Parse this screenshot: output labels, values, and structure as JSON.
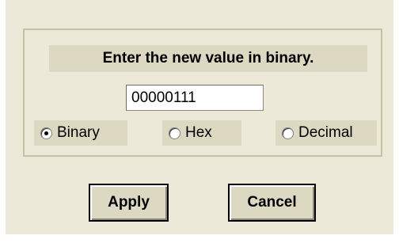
{
  "dialog": {
    "instruction": "Enter the new value in binary.",
    "value_input": "00000111",
    "radios": {
      "binary": {
        "label": "Binary",
        "checked": true
      },
      "hex": {
        "label": "Hex",
        "checked": false
      },
      "decimal": {
        "label": "Decimal",
        "checked": false
      }
    },
    "buttons": {
      "apply": "Apply",
      "cancel": "Cancel"
    }
  },
  "colors": {
    "dialog_background": "#ece9d8",
    "label_background": "#ddd8c2",
    "group_border": "#c8c1a6"
  }
}
